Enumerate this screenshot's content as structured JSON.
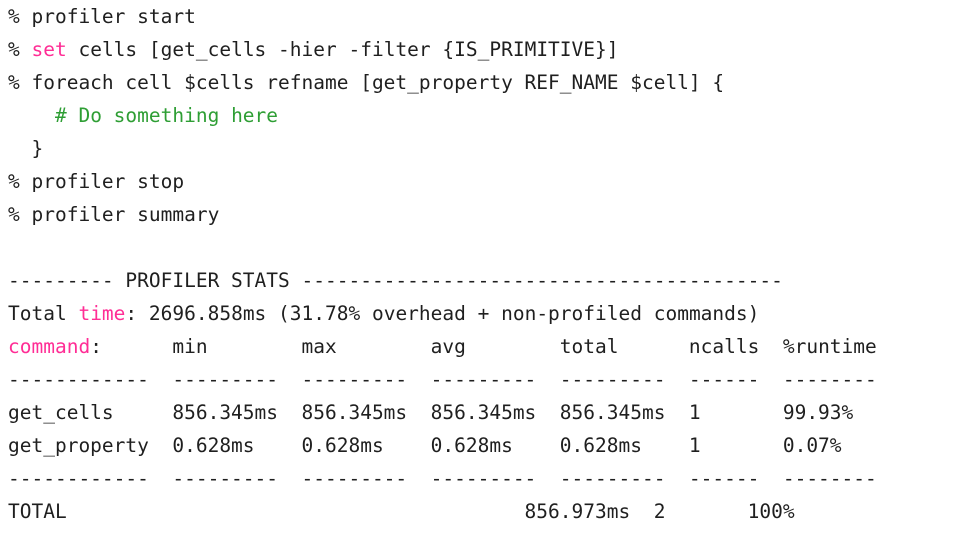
{
  "console": {
    "prompt_char": "%",
    "lines": [
      {
        "id": "cmd-profiler-start",
        "type": "command",
        "segments": [
          {
            "text": "% profiler start",
            "style": "plain"
          }
        ]
      },
      {
        "id": "cmd-set-cells",
        "type": "command",
        "segments": [
          {
            "text": "% ",
            "style": "plain"
          },
          {
            "text": "set",
            "style": "keyword"
          },
          {
            "text": " cells [get_cells -hier -filter {IS_PRIMITIVE}]",
            "style": "plain"
          }
        ]
      },
      {
        "id": "cmd-foreach",
        "type": "command",
        "segments": [
          {
            "text": "% foreach cell $cells refname [get_property REF_NAME $cell] {",
            "style": "plain"
          }
        ]
      },
      {
        "id": "cmd-comment",
        "type": "comment",
        "segments": [
          {
            "text": "    ",
            "style": "plain"
          },
          {
            "text": "# Do something here",
            "style": "comment"
          }
        ]
      },
      {
        "id": "cmd-closing-brace",
        "type": "command",
        "segments": [
          {
            "text": "  }",
            "style": "plain"
          }
        ]
      },
      {
        "id": "cmd-profiler-stop",
        "type": "command",
        "segments": [
          {
            "text": "% profiler stop",
            "style": "plain"
          }
        ]
      },
      {
        "id": "cmd-profiler-summary",
        "type": "command",
        "segments": [
          {
            "text": "% profiler summary",
            "style": "plain"
          }
        ]
      },
      {
        "id": "blank-1",
        "type": "blank",
        "segments": [
          {
            "text": " ",
            "style": "plain"
          }
        ]
      },
      {
        "id": "stats-header-rule",
        "type": "output",
        "segments": [
          {
            "text": "--------- PROFILER STATS -----------------------------------------",
            "style": "plain"
          }
        ]
      },
      {
        "id": "stats-total-time",
        "type": "output",
        "segments": [
          {
            "text": "Total ",
            "style": "plain"
          },
          {
            "text": "time",
            "style": "keyword"
          },
          {
            "text": ": 2696.858ms (31.78% overhead + non-profiled commands)",
            "style": "plain"
          }
        ]
      },
      {
        "id": "stats-column-headers",
        "type": "output",
        "segments": [
          {
            "text": "command",
            "style": "keyword"
          },
          {
            "text": ":      min        max        avg        total      ncalls  %runtime",
            "style": "plain"
          }
        ]
      },
      {
        "id": "stats-rule-top",
        "type": "output",
        "segments": [
          {
            "text": "------------  ---------  ---------  ---------  ---------  ------  --------",
            "style": "plain"
          }
        ]
      },
      {
        "id": "stats-row-get-cells",
        "type": "output",
        "segments": [
          {
            "text": "get_cells     856.345ms  856.345ms  856.345ms  856.345ms  1       99.93%",
            "style": "plain"
          }
        ]
      },
      {
        "id": "stats-row-get-property",
        "type": "output",
        "segments": [
          {
            "text": "get_property  0.628ms    0.628ms    0.628ms    0.628ms    1       0.07%",
            "style": "plain"
          }
        ]
      },
      {
        "id": "stats-rule-bottom",
        "type": "output",
        "segments": [
          {
            "text": "------------  ---------  ---------  ---------  ---------  ------  --------",
            "style": "plain"
          }
        ]
      },
      {
        "id": "stats-row-total",
        "type": "output",
        "segments": [
          {
            "text": "TOTAL                                       856.973ms  2       100%",
            "style": "plain"
          }
        ]
      }
    ]
  },
  "profiler_summary": {
    "section_title": "PROFILER STATS",
    "total_time_label": "Total time",
    "total_time_value": "2696.858ms",
    "overhead_note": "(31.78% overhead + non-profiled commands)",
    "overhead_percent": "31.78%",
    "columns": [
      "command:",
      "min",
      "max",
      "avg",
      "total",
      "ncalls",
      "%runtime"
    ],
    "rows": [
      {
        "command": "get_cells",
        "min": "856.345ms",
        "max": "856.345ms",
        "avg": "856.345ms",
        "total": "856.345ms",
        "ncalls": "1",
        "runtime_pct": "99.93%"
      },
      {
        "command": "get_property",
        "min": "0.628ms",
        "max": "0.628ms",
        "avg": "0.628ms",
        "total": "0.628ms",
        "ncalls": "1",
        "runtime_pct": "0.07%"
      }
    ],
    "total_row": {
      "command": "TOTAL",
      "min": "",
      "max": "",
      "avg": "",
      "total": "856.973ms",
      "ncalls": "2",
      "runtime_pct": "100%"
    }
  },
  "colors": {
    "background": "#ffffff",
    "text": "#1f1f1f",
    "keyword": "#ff2d95",
    "comment": "#2e9e34"
  }
}
